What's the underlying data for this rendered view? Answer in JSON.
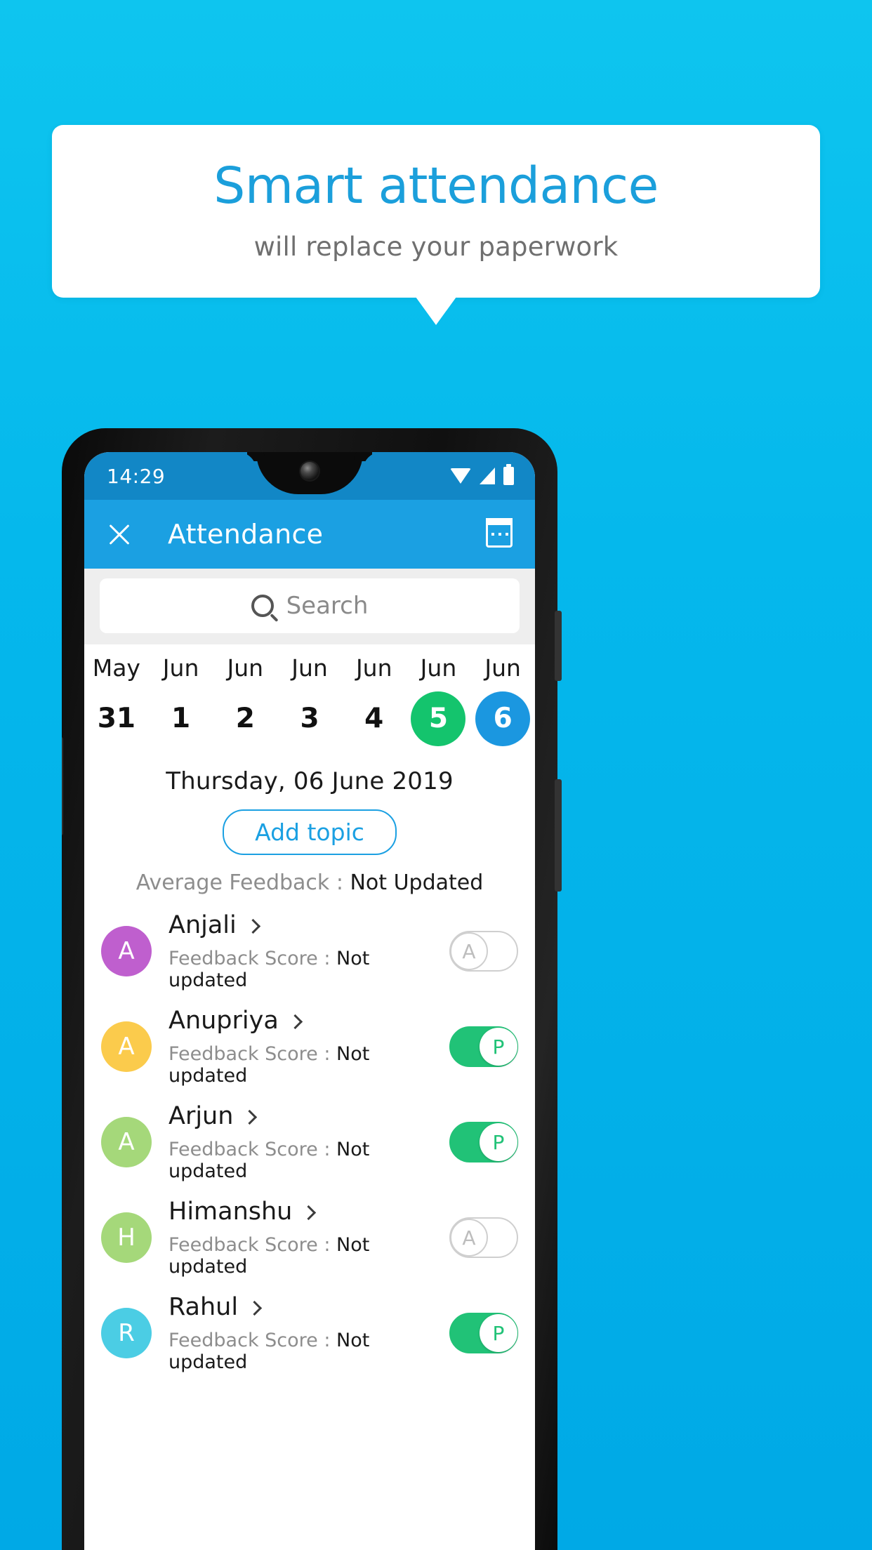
{
  "promo": {
    "headline": "Smart attendance",
    "subline": "will replace your paperwork"
  },
  "colors": {
    "background_top": "#0ec5ef",
    "background_bottom": "#00a9e6",
    "accent_blue": "#1ba0e2",
    "accent_green": "#21c277",
    "selected_day_green": "#14c46d",
    "selected_day_blue": "#1b97e0"
  },
  "phone": {
    "status_bar": {
      "time": "14:29",
      "icons": [
        "wifi-icon",
        "signal-icon",
        "battery-icon"
      ]
    },
    "app_bar": {
      "close_icon": "close-icon",
      "title": "Attendance",
      "calendar_icon": "calendar-icon"
    },
    "search": {
      "icon": "search-icon",
      "placeholder": "Search",
      "value": ""
    },
    "date_strip": [
      {
        "month": "May",
        "day": "31",
        "state": "normal"
      },
      {
        "month": "Jun",
        "day": "1",
        "state": "normal"
      },
      {
        "month": "Jun",
        "day": "2",
        "state": "normal"
      },
      {
        "month": "Jun",
        "day": "3",
        "state": "normal"
      },
      {
        "month": "Jun",
        "day": "4",
        "state": "normal"
      },
      {
        "month": "Jun",
        "day": "5",
        "state": "green"
      },
      {
        "month": "Jun",
        "day": "6",
        "state": "blue"
      }
    ],
    "selected_date_label": "Thursday, 06 June 2019",
    "add_topic_label": "Add topic",
    "average_feedback": {
      "label": "Average Feedback : ",
      "value": "Not Updated"
    },
    "feedback_label": "Feedback Score : ",
    "students": [
      {
        "name": "Anjali",
        "initial": "A",
        "avatar_color": "#bf5fce",
        "feedback_value": "Not updated",
        "attendance": "A",
        "attendance_on": false,
        "chevron_icon": "chevron-right-icon"
      },
      {
        "name": "Anupriya",
        "initial": "A",
        "avatar_color": "#fbcb4c",
        "feedback_value": "Not updated",
        "attendance": "P",
        "attendance_on": true,
        "chevron_icon": "chevron-right-icon"
      },
      {
        "name": "Arjun",
        "initial": "A",
        "avatar_color": "#a5d87a",
        "feedback_value": "Not updated",
        "attendance": "P",
        "attendance_on": true,
        "chevron_icon": "chevron-right-icon"
      },
      {
        "name": "Himanshu",
        "initial": "H",
        "avatar_color": "#a5d87a",
        "feedback_value": "Not updated",
        "attendance": "A",
        "attendance_on": false,
        "chevron_icon": "chevron-right-icon"
      },
      {
        "name": "Rahul",
        "initial": "R",
        "avatar_color": "#4bcde4",
        "feedback_value": "Not updated",
        "attendance": "P",
        "attendance_on": true,
        "chevron_icon": "chevron-right-icon"
      }
    ]
  }
}
